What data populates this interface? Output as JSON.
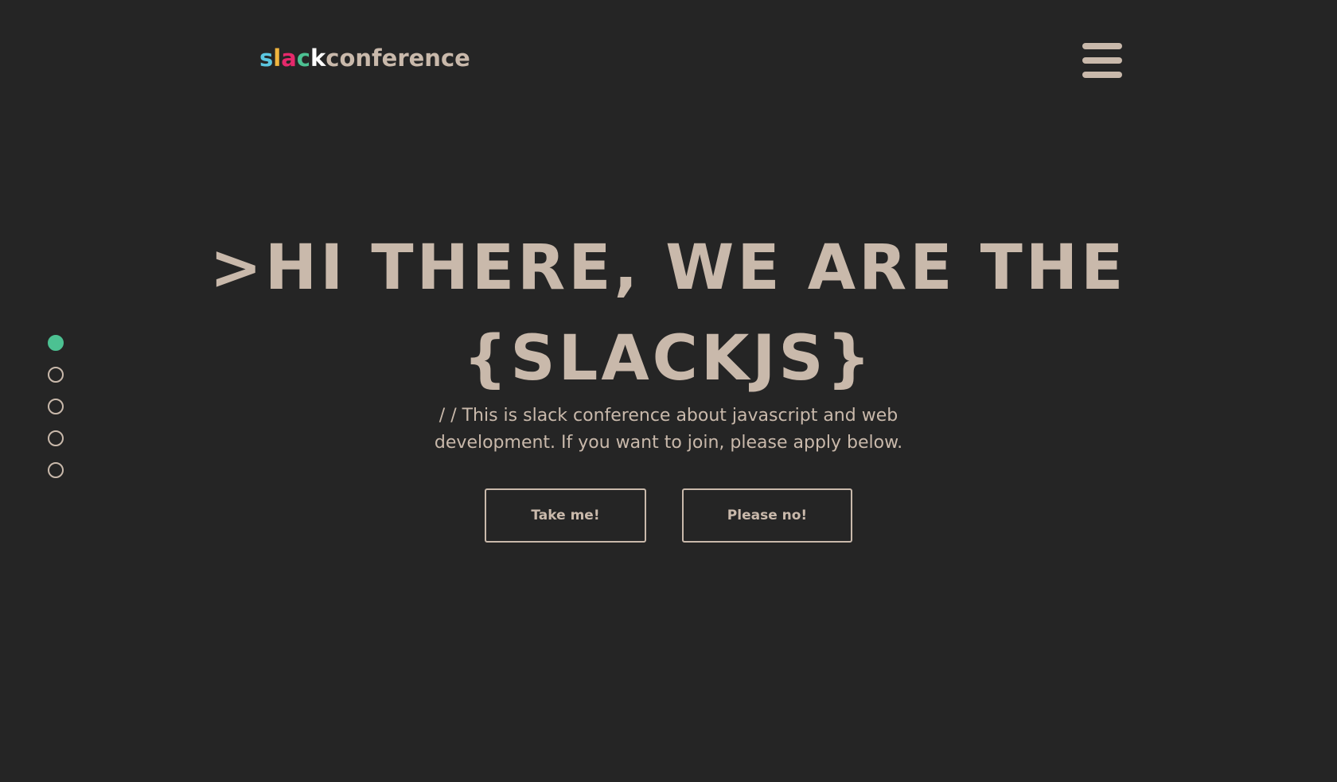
{
  "header": {
    "logo": {
      "parts": [
        {
          "text": "s",
          "color": "#5bc6e0"
        },
        {
          "text": "l",
          "color": "#f0b53e"
        },
        {
          "text": "a",
          "color": "#e5296b"
        },
        {
          "text": "c",
          "color": "#4cc192"
        },
        {
          "text": "k",
          "color": "#ffffff"
        },
        {
          "text": "conference",
          "color": "#c9b9ab"
        }
      ]
    },
    "menu_icon": "hamburger-icon"
  },
  "side_nav": {
    "dots": [
      {
        "name": "slide-1",
        "active": true
      },
      {
        "name": "slide-2",
        "active": false
      },
      {
        "name": "slide-3",
        "active": false
      },
      {
        "name": "slide-4",
        "active": false
      },
      {
        "name": "slide-5",
        "active": false
      }
    ],
    "active_color": "#4cc192"
  },
  "hero": {
    "title_line1": ">HI THERE, WE ARE THE",
    "title_line2": "{SLACKJS}",
    "subtitle": "/ / This is slack conference about javascript and web development. If you want to join, please apply below."
  },
  "actions": {
    "take_label": "Take me!",
    "no_label": "Please no!"
  },
  "colors": {
    "background": "#252525",
    "text": "#c9b9ab",
    "accent": "#4cc192"
  }
}
